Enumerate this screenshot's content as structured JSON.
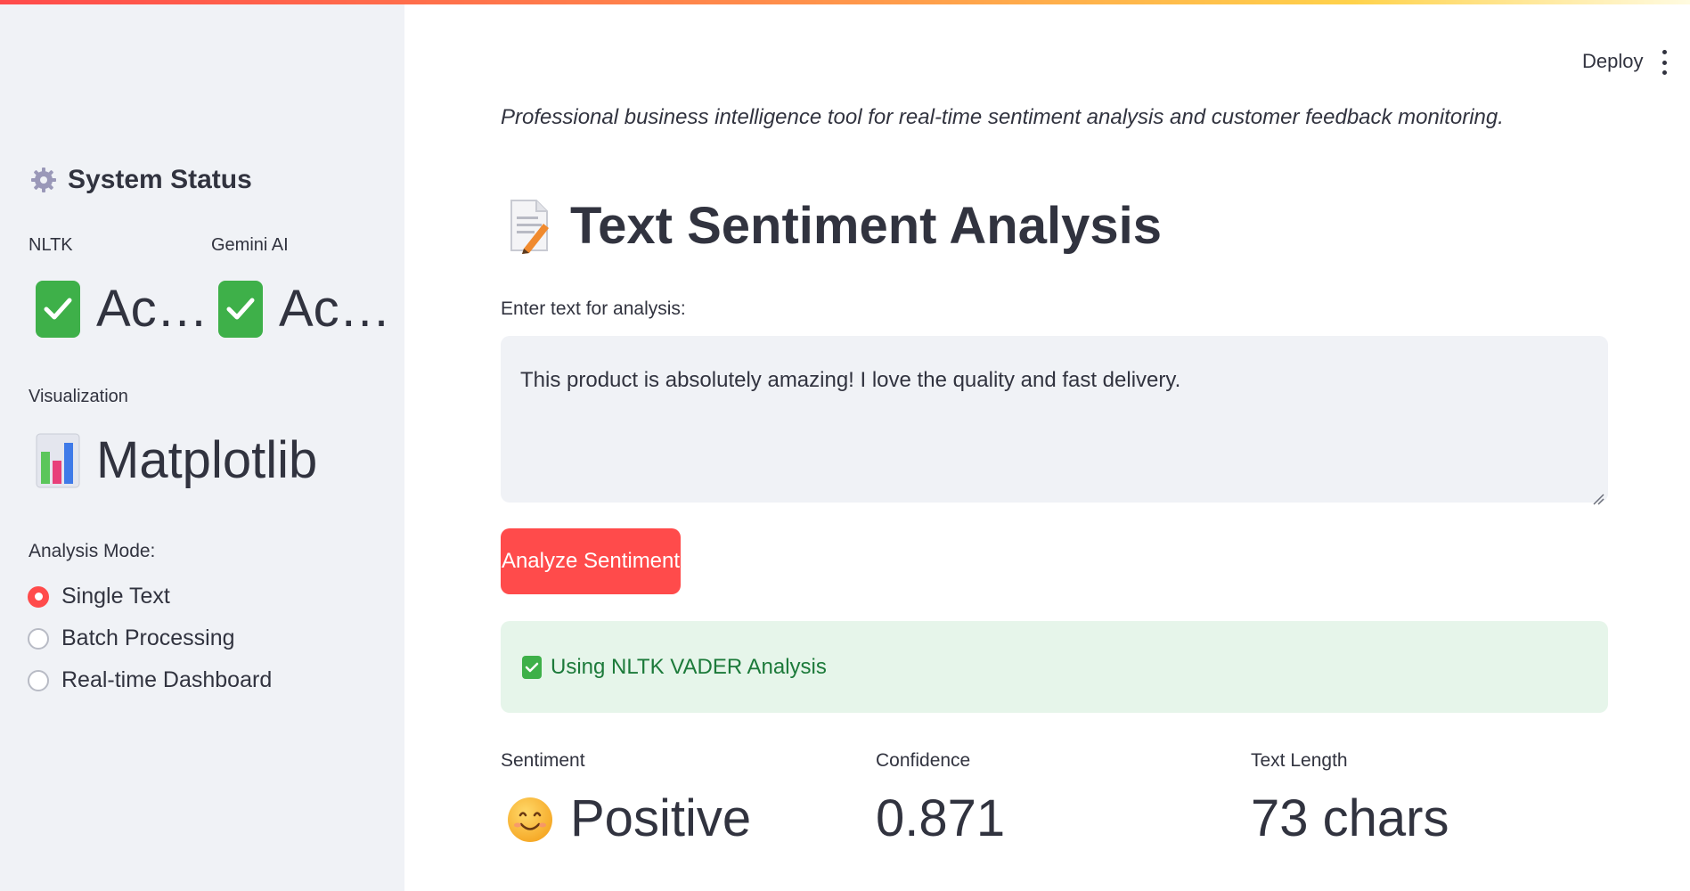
{
  "sidebar": {
    "heading": "System Status",
    "metrics": [
      {
        "label": "NLTK",
        "value": "Ac…",
        "icon": "check-mark-button-icon"
      },
      {
        "label": "Gemini AI",
        "value": "Ac…",
        "icon": "check-mark-button-icon"
      },
      {
        "label": "Visualization",
        "value": "Matplotlib",
        "icon": "bar-chart-icon"
      }
    ],
    "analysis_mode": {
      "label": "Analysis Mode:",
      "options": [
        "Single Text",
        "Batch Processing",
        "Real-time Dashboard"
      ],
      "selected": "Single Text"
    }
  },
  "header": {
    "deploy_label": "Deploy",
    "menu_icon": "vertical-ellipsis-icon"
  },
  "main": {
    "caption": "Professional business intelligence tool for real-time sentiment analysis and customer feedback monitoring.",
    "title": "Text Sentiment Analysis",
    "title_icon": "memo-icon",
    "input": {
      "label": "Enter text for analysis:",
      "value": "This product is absolutely amazing! I love the quality and fast delivery."
    },
    "analyze_button": "Analyze Sentiment",
    "status_message": "Using NLTK VADER Analysis",
    "results": [
      {
        "label": "Sentiment",
        "value": "Positive",
        "icon": "smiling-face-icon"
      },
      {
        "label": "Confidence",
        "value": "0.871"
      },
      {
        "label": "Text Length",
        "value": "73 chars"
      }
    ]
  },
  "colors": {
    "accent": "#ff4b4b",
    "sidebar_bg": "#f0f2f6",
    "success_bg": "#e6f5ea",
    "success_text": "#1c7a3a",
    "text": "#31333f"
  }
}
